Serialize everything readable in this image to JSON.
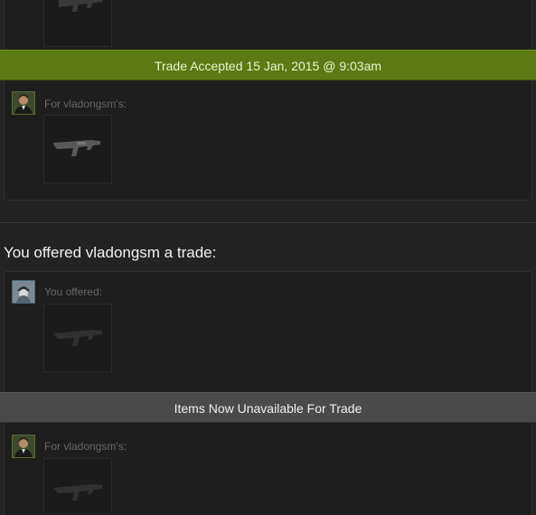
{
  "trade1": {
    "status_banner": "Trade Accepted 15 Jan, 2015 @ 9:03am",
    "for_label": "For vladongsm's:"
  },
  "trade2": {
    "heading": "You offered vladongsm a trade:",
    "you_offered_label": "You offered:",
    "status_banner": "Items Now Unavailable For Trade",
    "for_label": "For vladongsm's:"
  },
  "icons": {
    "item": "rifle-icon",
    "avatar_user": "avatar-suit-icon",
    "avatar_self": "avatar-helmet-icon"
  },
  "colors": {
    "accepted_banner": "#5b7a13",
    "unavailable_banner": "#4a4a4a"
  }
}
